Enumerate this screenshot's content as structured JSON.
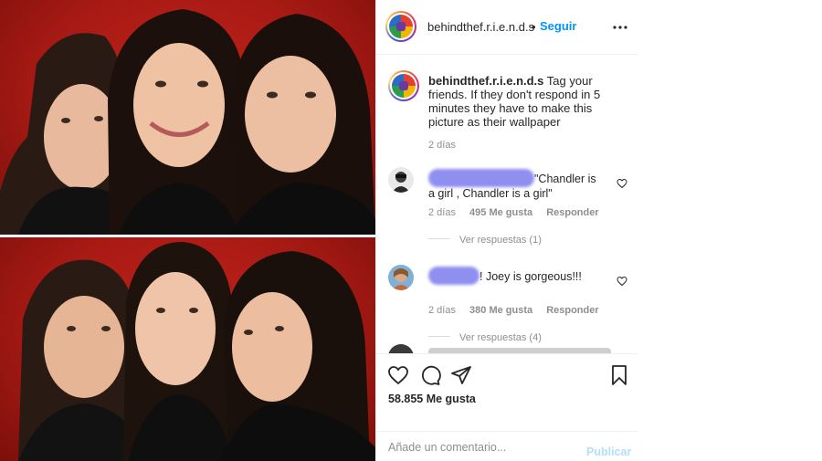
{
  "post": {
    "username": "behindthef.r.i.e.n.d.s",
    "separator": "•",
    "follow_label": "Seguir",
    "more_icon": "more-horizontal-icon",
    "caption": "Tag your friends. If they don't respond in 5 minutes they have to make this picture as their wallpaper",
    "caption_time": "2 días",
    "likes": "58.855 Me gusta",
    "photo_description_colors": {
      "background": "#b01c16",
      "clothing": "#101010"
    }
  },
  "comments": [
    {
      "text": "\"Chandler is a girl , Chandler is a girl\"",
      "time": "2 días",
      "likes": "495 Me gusta",
      "reply_label": "Responder",
      "view_replies": "Ver respuestas (1)"
    },
    {
      "text": "! Joey is gorgeous!!!",
      "time": "2 días",
      "likes": "380 Me gusta",
      "reply_label": "Responder",
      "view_replies": "Ver respuestas (4)"
    }
  ],
  "add_comment": {
    "placeholder": "Añade un comentario...",
    "publish_label": "Publicar"
  },
  "colors": {
    "accent": "#0095f6",
    "publish_disabled": "#b2dffc",
    "muted": "#8e8e8e",
    "redaction": "#8f8ff0"
  }
}
